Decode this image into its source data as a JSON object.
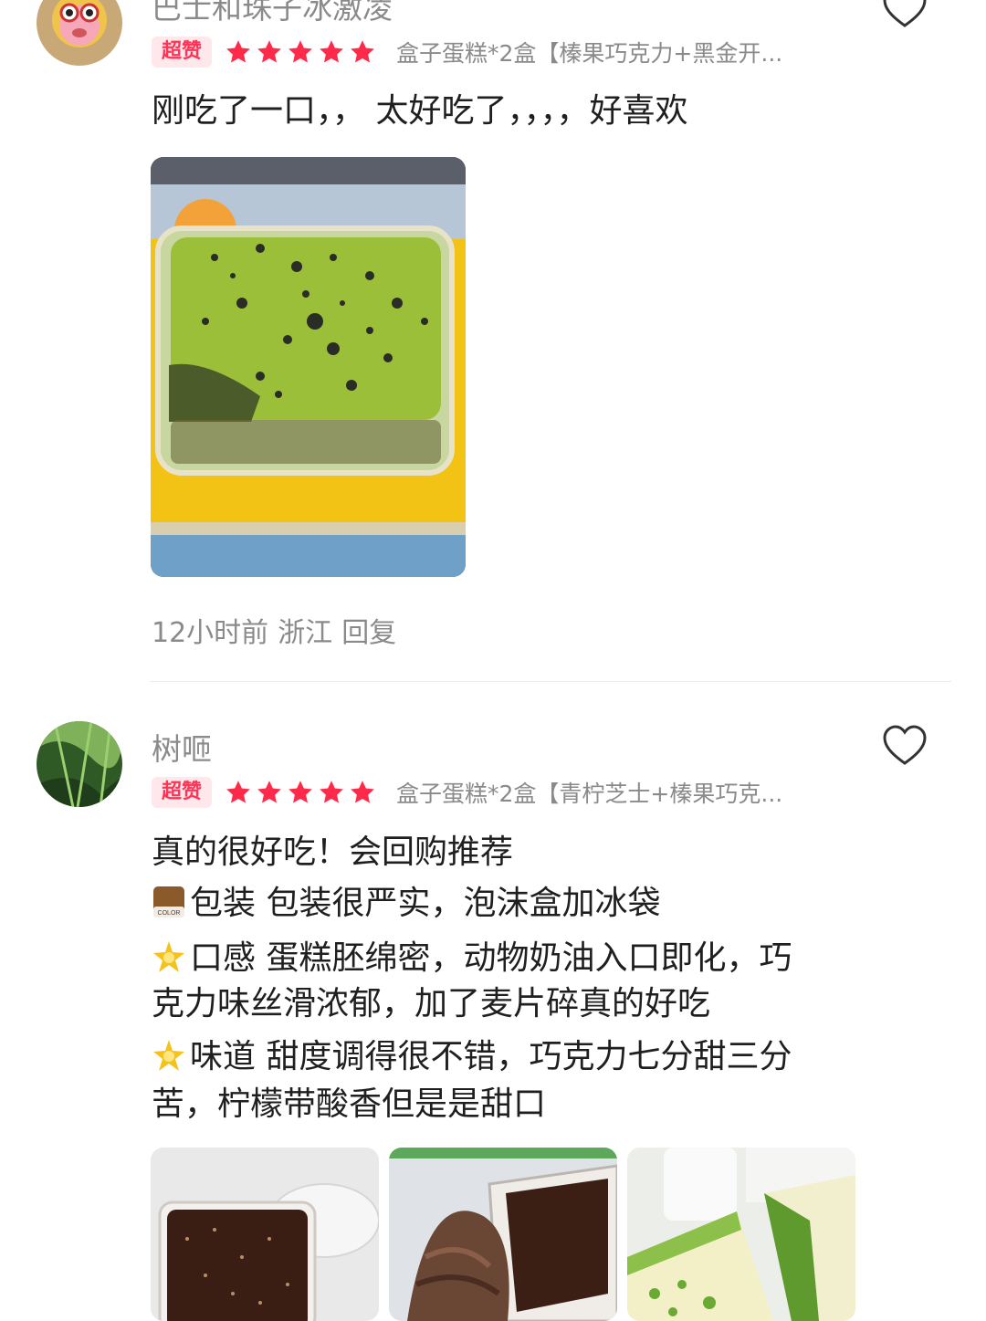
{
  "reviews": [
    {
      "username": "巴士和珠子冰激凌",
      "badge": "超赞",
      "rating": 5,
      "spec": "盒子蛋糕*2盒【榛果巧克力+黑金开...",
      "text_lines": [
        "刚吃了一口，， 太好吃了，，，，好喜欢"
      ],
      "time": "12小时前",
      "location": "浙江",
      "reply_label": "回复"
    },
    {
      "username": "树咂",
      "badge": "超赞",
      "rating": 5,
      "spec": "盒子蛋糕*2盒【青柠芝士+榛果巧克...",
      "text_lines": [
        "真的很好吃！会回购推荐",
        "包装 包装很严实，泡沫盒加冰袋",
        "口感 蛋糕胚绵密，动物奶油入口即化，巧",
        "克力味丝滑浓郁，加了麦片碎真的好吃",
        "味道 甜度调得很不错，巧克力七分甜三分",
        "苦，柠檬带酸香但是是甜口"
      ],
      "emoji_color_label": "COLOR"
    }
  ],
  "colors": {
    "badge_text": "#ff3355",
    "star": "#ff2a4a",
    "meta": "#8a8a8a"
  },
  "icons": {
    "like": "heart-icon",
    "rating": "star-icon"
  }
}
